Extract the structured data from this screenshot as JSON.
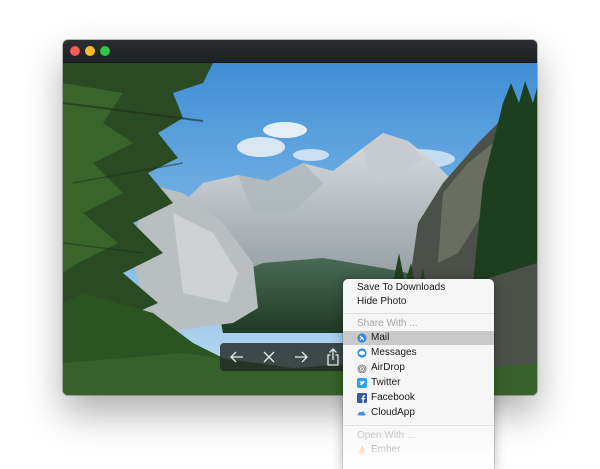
{
  "window": {
    "traffic_lights": [
      {
        "name": "close",
        "color": "#fc5b57"
      },
      {
        "name": "minimize",
        "color": "#fdbc2e"
      },
      {
        "name": "zoom",
        "color": "#33c748"
      }
    ]
  },
  "photo": {
    "subject": "mountain-valley-landscape"
  },
  "toolbar": {
    "buttons": [
      {
        "name": "previous",
        "icon": "arrow-left-icon"
      },
      {
        "name": "close",
        "icon": "close-icon"
      },
      {
        "name": "next",
        "icon": "arrow-right-icon"
      },
      {
        "name": "share",
        "icon": "share-icon"
      }
    ]
  },
  "menu": {
    "save_label": "Save To Downloads",
    "hide_label": "Hide Photo",
    "share_header": "Share With ...",
    "share_items": [
      {
        "label": "Mail",
        "icon": "mail-icon",
        "highlighted": true
      },
      {
        "label": "Messages",
        "icon": "messages-icon",
        "highlighted": false
      },
      {
        "label": "AirDrop",
        "icon": "airdrop-icon",
        "highlighted": false
      },
      {
        "label": "Twitter",
        "icon": "twitter-icon",
        "highlighted": false
      },
      {
        "label": "Facebook",
        "icon": "facebook-icon",
        "highlighted": false
      },
      {
        "label": "CloudApp",
        "icon": "cloudapp-icon",
        "highlighted": false
      }
    ],
    "open_header": "Open With ...",
    "open_items": [
      {
        "label": "Ember",
        "icon": "ember-icon"
      }
    ]
  },
  "colors": {
    "highlight": "#c9c9c9",
    "menu_background": "#f6f6f6",
    "twitter": "#2aa3ef",
    "facebook": "#3b5998"
  }
}
